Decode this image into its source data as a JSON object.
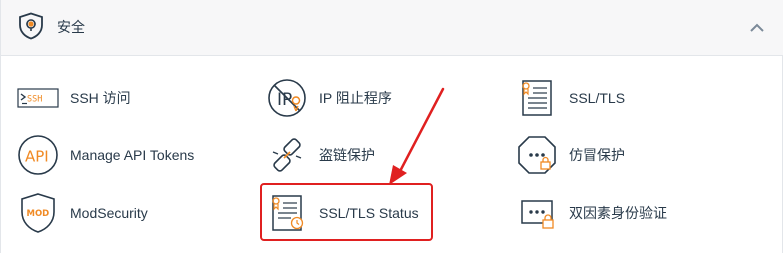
{
  "section": {
    "title": "安全",
    "icons": {
      "header": "shield-icon",
      "collapse": "chevron-up-icon"
    }
  },
  "items": [
    {
      "label": "SSH 访问",
      "icon": "ssh-terminal-icon"
    },
    {
      "label": "IP 阻止程序",
      "icon": "ip-blocker-icon"
    },
    {
      "label": "SSL/TLS",
      "icon": "certificate-icon"
    },
    {
      "label": "Manage API Tokens",
      "icon": "api-icon"
    },
    {
      "label": "盗链保护",
      "icon": "broken-link-icon"
    },
    {
      "label": "仿冒保护",
      "icon": "leech-protection-icon"
    },
    {
      "label": "ModSecurity",
      "icon": "modsecurity-shield-icon"
    },
    {
      "label": "SSL/TLS Status",
      "icon": "certificate-status-icon"
    },
    {
      "label": "双因素身份验证",
      "icon": "two-factor-icon"
    }
  ],
  "highlight": {
    "target": "SSL/TLS Status",
    "color": "#e02020"
  },
  "colors": {
    "accent": "#f08a24",
    "icon": "#293a4a",
    "annotation": "#e02020"
  }
}
